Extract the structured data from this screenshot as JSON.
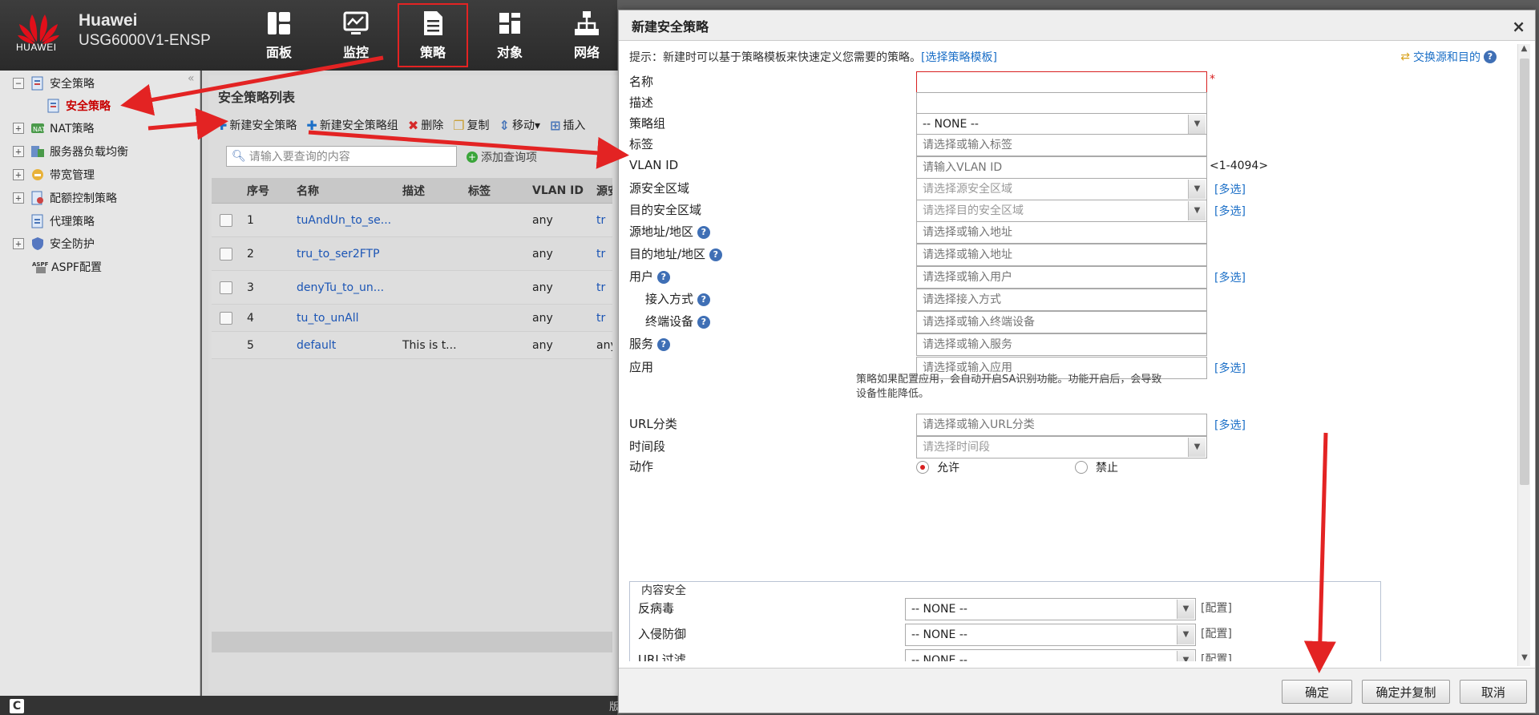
{
  "header": {
    "logo_text": "HUAWEI",
    "brand": "Huawei",
    "model": "USG6000V1-ENSP",
    "nav": [
      {
        "label": "面板",
        "icon": "dashboard-icon"
      },
      {
        "label": "监控",
        "icon": "monitor-icon"
      },
      {
        "label": "策略",
        "icon": "policy-icon",
        "active": true
      },
      {
        "label": "对象",
        "icon": "object-icon"
      },
      {
        "label": "网络",
        "icon": "network-icon"
      }
    ]
  },
  "sidebar": {
    "items": [
      {
        "label": "安全策略",
        "expander": "−",
        "icon": "security-policy-icon"
      },
      {
        "label": "安全策略",
        "selected": true,
        "icon": "security-policy-icon"
      },
      {
        "label": "NAT策略",
        "expander": "+",
        "icon": "nat-icon"
      },
      {
        "label": "服务器负载均衡",
        "expander": "+",
        "icon": "server-lb-icon"
      },
      {
        "label": "带宽管理",
        "expander": "+",
        "icon": "bandwidth-icon"
      },
      {
        "label": "配额控制策略",
        "expander": "+",
        "icon": "quota-icon"
      },
      {
        "label": "代理策略",
        "icon": "proxy-icon"
      },
      {
        "label": "安全防护",
        "expander": "+",
        "icon": "shield-icon"
      },
      {
        "label": "ASPF配置",
        "icon": "aspf-icon"
      }
    ],
    "collapse": "«"
  },
  "list": {
    "title": "安全策略列表",
    "toolbar": {
      "new_policy": "新建安全策略",
      "new_group": "新建安全策略组",
      "delete": "删除",
      "copy": "复制",
      "move": "移动▾",
      "insert": "插入"
    },
    "search_placeholder": "请输入要查询的内容",
    "add_condition": "添加查询项",
    "columns": [
      "序号",
      "名称",
      "描述",
      "标签",
      "VLAN ID",
      "源安"
    ],
    "rows": [
      {
        "no": "1",
        "name": "tuAndUn_to_se...",
        "desc": "",
        "tag": "",
        "vlan": "any",
        "src": "tr"
      },
      {
        "no": "2",
        "name": "tru_to_ser2FTP",
        "desc": "",
        "tag": "",
        "vlan": "any",
        "src": "tr"
      },
      {
        "no": "3",
        "name": "denyTu_to_un...",
        "desc": "",
        "tag": "",
        "vlan": "any",
        "src": "tr"
      },
      {
        "no": "4",
        "name": "tu_to_unAll",
        "desc": "",
        "tag": "",
        "vlan": "any",
        "src": "tr"
      },
      {
        "no": "5",
        "name": "default",
        "desc": "This is t...",
        "tag": "",
        "vlan": "any",
        "src": "any"
      }
    ]
  },
  "status": {
    "logo": "C",
    "trailing": "版"
  },
  "dialog": {
    "title": "新建安全策略",
    "close": "×",
    "hint_prefix": "提示：新建时可以基于策略模板来快速定义您需要的策略。",
    "hint_link": "[选择策略模板]",
    "swap": "交换源和目的",
    "fields": {
      "name": {
        "label": "名称",
        "value": ""
      },
      "desc": {
        "label": "描述",
        "value": ""
      },
      "group": {
        "label": "策略组",
        "value": "-- NONE --"
      },
      "tag": {
        "label": "标签",
        "placeholder": "请选择或输入标签"
      },
      "vlan": {
        "label": "VLAN ID",
        "placeholder": "请输入VLAN ID",
        "range": "<1-4094>"
      },
      "src_zone": {
        "label": "源安全区域",
        "placeholder": "请选择源安全区域",
        "multi": "[多选]"
      },
      "dst_zone": {
        "label": "目的安全区域",
        "placeholder": "请选择目的安全区域",
        "multi": "[多选]"
      },
      "src_addr": {
        "label": "源地址/地区",
        "placeholder": "请选择或输入地址"
      },
      "dst_addr": {
        "label": "目的地址/地区",
        "placeholder": "请选择或输入地址"
      },
      "user": {
        "label": "用户",
        "placeholder": "请选择或输入用户",
        "multi": "[多选]"
      },
      "access": {
        "label": "接入方式",
        "placeholder": "请选择接入方式"
      },
      "terminal": {
        "label": "终端设备",
        "placeholder": "请选择或输入终端设备"
      },
      "service": {
        "label": "服务",
        "placeholder": "请选择或输入服务"
      },
      "app": {
        "label": "应用",
        "placeholder": "请选择或输入应用",
        "multi": "[多选]"
      },
      "app_note": "策略如果配置应用，会自动开启SA识别功能。功能开启后，会导致设备性能降低。",
      "url": {
        "label": "URL分类",
        "placeholder": "请选择或输入URL分类",
        "multi": "[多选]"
      },
      "time": {
        "label": "时间段",
        "placeholder": "请选择时间段"
      },
      "action": {
        "label": "动作",
        "allow": "允许",
        "deny": "禁止",
        "selected": "允许"
      }
    },
    "content_security": {
      "legend": "内容安全",
      "rows": [
        {
          "label": "反病毒",
          "value": "-- NONE --",
          "config": "[配置]"
        },
        {
          "label": "入侵防御",
          "value": "-- NONE --",
          "config": "[配置]"
        },
        {
          "label": "URL过滤",
          "value": "-- NONE --",
          "config": "[配置]"
        }
      ]
    },
    "buttons": {
      "ok": "确定",
      "ok_copy": "确定并复制",
      "cancel": "取消"
    }
  },
  "colors": {
    "accent": "#1b6fc7",
    "error": "#d82020",
    "annotation": "#e32323",
    "topbar": "#333333"
  }
}
